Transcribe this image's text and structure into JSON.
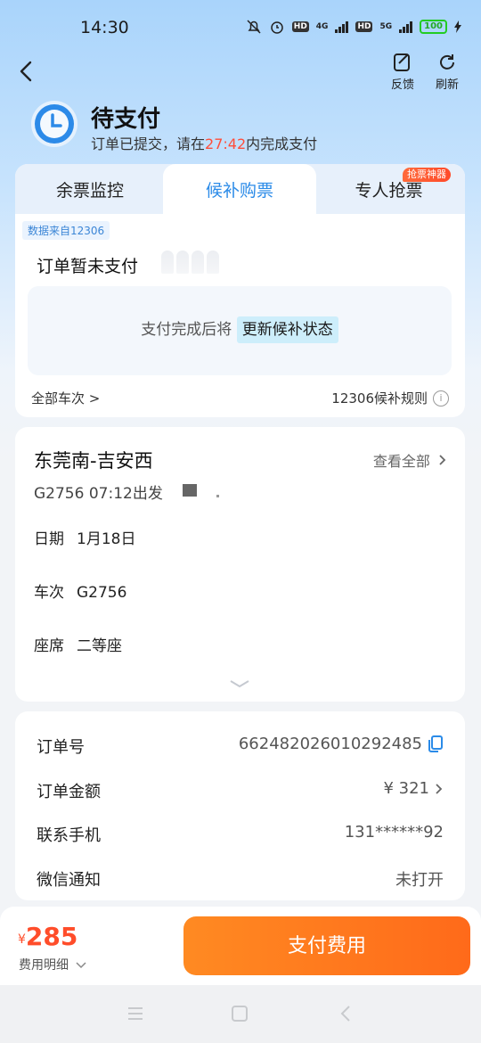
{
  "status_bar": {
    "time": "14:30",
    "battery": "100",
    "net1": "4G",
    "net2": "5G",
    "hd": "HD"
  },
  "header": {
    "feedback_label": "反馈",
    "refresh_label": "刷新",
    "title": "待支付",
    "subtitle_prefix": "订单已提交，请在",
    "countdown": "27:42",
    "subtitle_suffix": "内完成支付"
  },
  "tabs": {
    "items": [
      {
        "label": "余票监控"
      },
      {
        "label": "候补购票"
      },
      {
        "label": "专人抢票"
      }
    ],
    "active_index": 1,
    "badge": "抢票神器"
  },
  "status_card": {
    "source_tag": "数据来自12306",
    "status_text": "订单暂未支付",
    "notice_prefix": "支付完成后将",
    "notice_highlight": "更新候补状态",
    "all_trains_link": "全部车次 >",
    "rules_link": "12306候补规则",
    "info_glyph": "i"
  },
  "trip": {
    "route": "东莞南-吉安西",
    "view_all": "查看全部",
    "train_line": "G2756 07:12出发",
    "date_label": "日期",
    "date_value": "1月18日",
    "train_label": "车次",
    "train_value": "G2756",
    "seat_label": "座席",
    "seat_value": "二等座"
  },
  "order": {
    "order_no_label": "订单号",
    "order_no": "662482026010292485",
    "amount_label": "订单金额",
    "amount": "¥ 321",
    "phone_label": "联系手机",
    "phone": "131******92",
    "wechat_label": "微信通知",
    "wechat_value": "未打开"
  },
  "bottom": {
    "currency": "¥",
    "price": "285",
    "fee_detail": "费用明细",
    "pay_button": "支付费用"
  },
  "colors": {
    "accent": "#2b8be8",
    "orange": "#ff7a1e",
    "red": "#ff4d3a"
  }
}
